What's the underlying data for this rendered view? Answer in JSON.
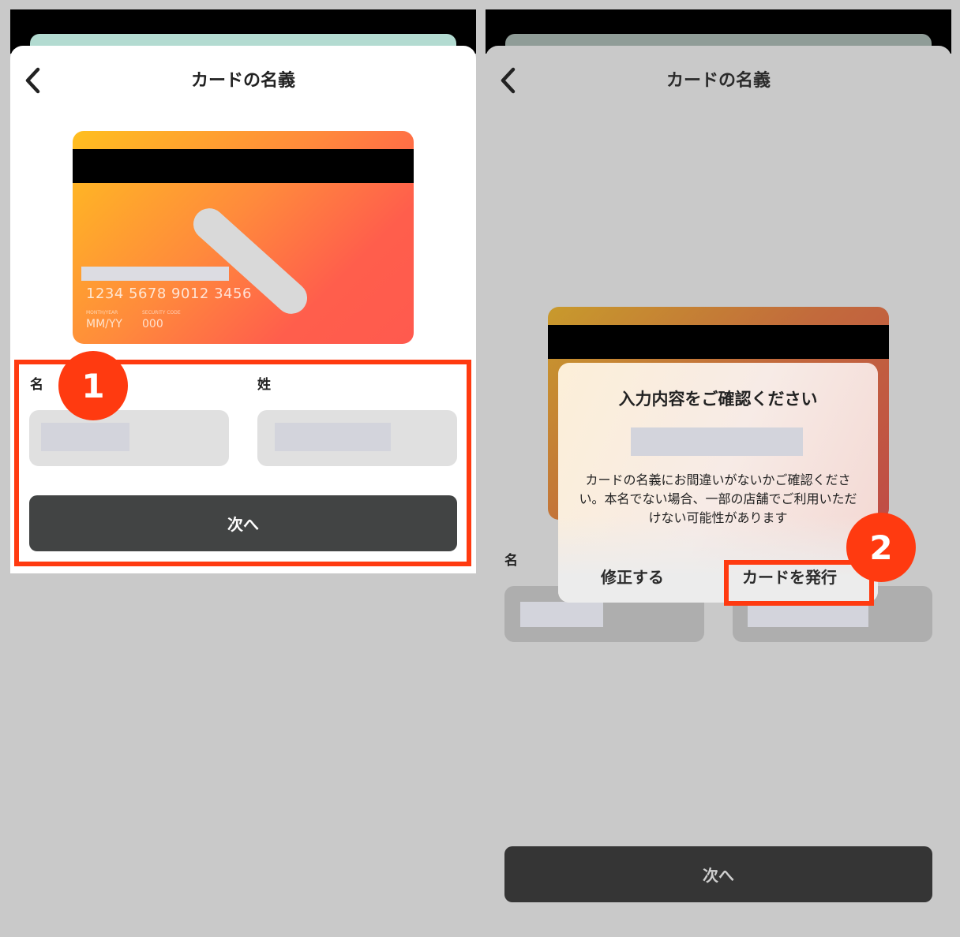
{
  "colors": {
    "accent_red": "#ff3a10",
    "button_dark": "#424444",
    "button_dark_dim": "#353535",
    "card_gradient": [
      "#ffbf1f",
      "#ff8a3c",
      "#ff5e4c"
    ],
    "input_bg": "#e0e0e0"
  },
  "left": {
    "title": "カードの名義",
    "back_icon": "chevron-left-icon",
    "card": {
      "number": "1234 5678 9012 3456",
      "expiry_label": "MONTH/YEAR",
      "expiry": "MM/YY",
      "security_label": "SECURITY CODE",
      "security": "000"
    },
    "first_name_label": "名",
    "last_name_label": "姓",
    "next_label": "次へ",
    "step_badge": "1"
  },
  "right": {
    "title": "カードの名義",
    "back_icon": "chevron-left-icon",
    "first_name_label": "名",
    "next_label": "次へ",
    "step_badge": "2",
    "dialog": {
      "title": "入力内容をご確認ください",
      "message": "カードの名義にお間違いがないかご確認ください。本名でない場合、一部の店舗でご利用いただけない可能性があります",
      "edit_label": "修正する",
      "issue_label": "カードを発行"
    }
  }
}
